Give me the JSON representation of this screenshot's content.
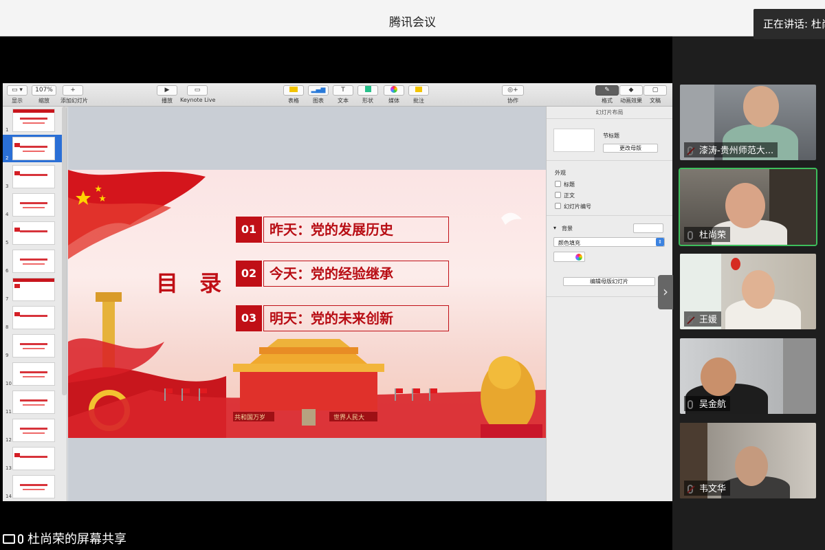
{
  "window": {
    "title": "腾讯会议",
    "speaking": "正在讲话: 杜尚荣"
  },
  "keynote": {
    "toolbar": {
      "view": "显示",
      "zoom_value": "107%",
      "zoom": "缩放",
      "add_slide": "添加幻灯片",
      "play": "播放",
      "keynote_live": "Keynote Live",
      "table": "表格",
      "chart": "图表",
      "text": "文本",
      "shape": "形状",
      "media": "媒体",
      "comment": "批注",
      "collaborate": "协作",
      "format": "格式",
      "animate": "动画效果",
      "document": "文稿"
    },
    "slide_numbers": [
      "1",
      "2",
      "3",
      "4",
      "5",
      "6",
      "7",
      "8",
      "9",
      "10",
      "11",
      "12",
      "13",
      "14"
    ],
    "slide": {
      "title": "目 录",
      "items": [
        {
          "num": "01",
          "text": "昨天：党的发展历史"
        },
        {
          "num": "02",
          "text": "今天：党的经验继承"
        },
        {
          "num": "03",
          "text": "明天：党的未来创新"
        }
      ],
      "banner_left": "共和国万岁",
      "banner_right": "世界人民大"
    },
    "inspector": {
      "header": "幻灯片布局",
      "layout_name": "节标题",
      "change_master": "更改母版",
      "appearance": "外观",
      "checkbox_title": "标题",
      "checkbox_body": "正文",
      "checkbox_slide_number": "幻灯片编号",
      "background": "背景",
      "fill_type": "颜色填充",
      "edit_master": "编辑母版幻灯片"
    }
  },
  "participants": [
    {
      "name": "漆涛-贵州师范大...",
      "muted": true
    },
    {
      "name": "杜尚荣",
      "muted": false,
      "active": true
    },
    {
      "name": "王媛",
      "muted": true
    },
    {
      "name": "吴金航",
      "muted": false
    },
    {
      "name": "韦文华",
      "muted": true
    }
  ],
  "footer": {
    "share_label": "杜尚荣的屏幕共享"
  },
  "colors": {
    "accent_red": "#c00f16",
    "active_speaker": "#3dbf5c"
  }
}
